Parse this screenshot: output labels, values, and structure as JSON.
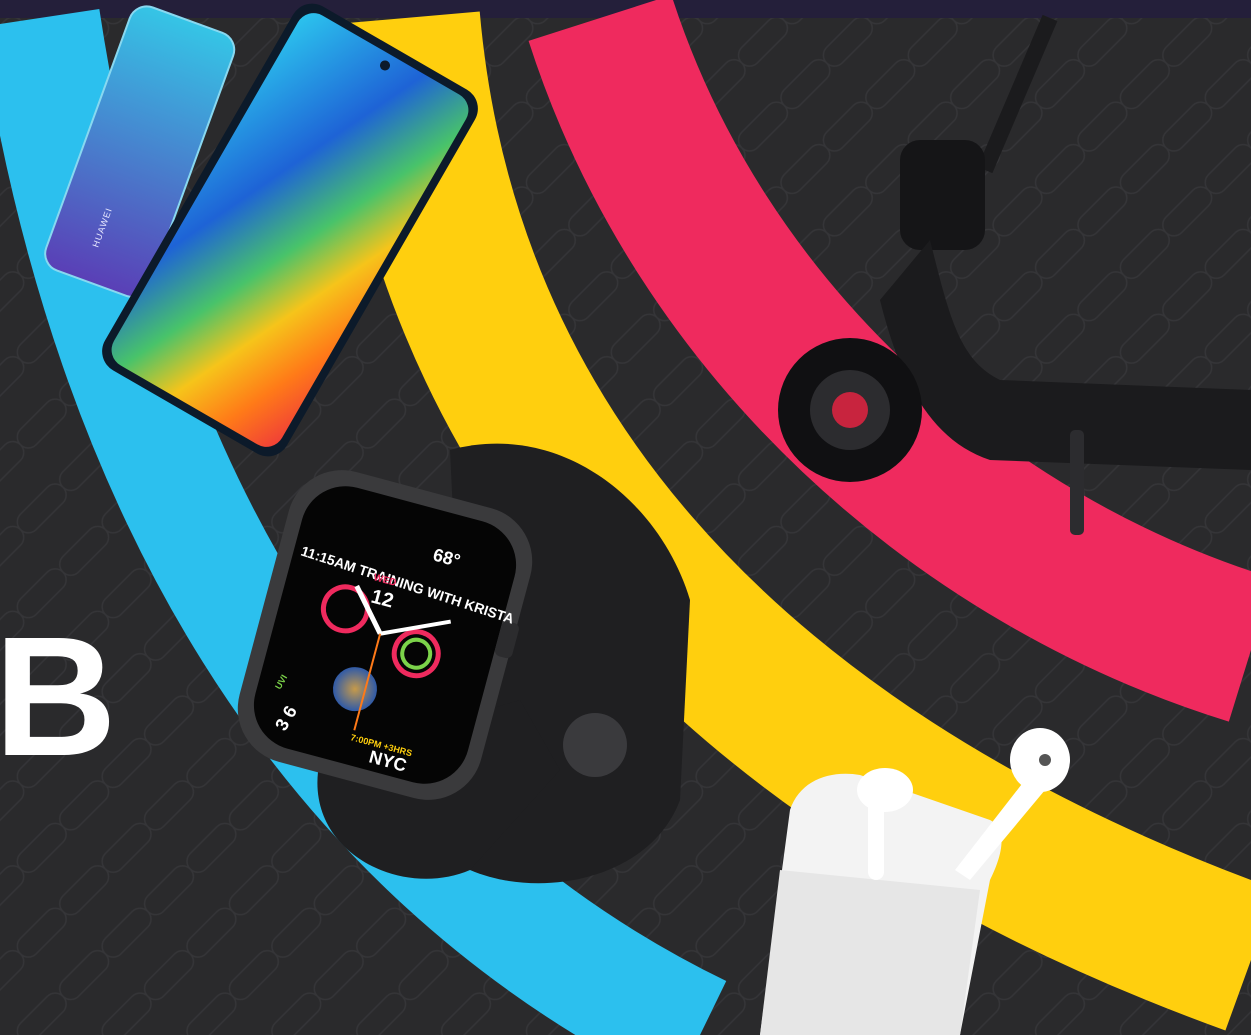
{
  "hero": {
    "letter": "B"
  },
  "phone": {
    "brand": "HUAWEI"
  },
  "watch": {
    "complication_text": "11:15AM TRAINING WITH KRISTA",
    "date_day": "WED",
    "date_num": "12",
    "temperature": "68°",
    "uv_index": "3 6",
    "uv_label": "UVI",
    "city": "NYC",
    "world_time": "7:00PM +3HRS"
  },
  "colors": {
    "background": "#2a2a2c",
    "top_bar": "#241f3a",
    "stripe_blue": "#2cc0ee",
    "stripe_yellow": "#ffcf0e",
    "stripe_pink": "#ef2a5e"
  },
  "icons": [
    "phone-image",
    "watch-image",
    "scooter-image",
    "earbuds-image"
  ]
}
